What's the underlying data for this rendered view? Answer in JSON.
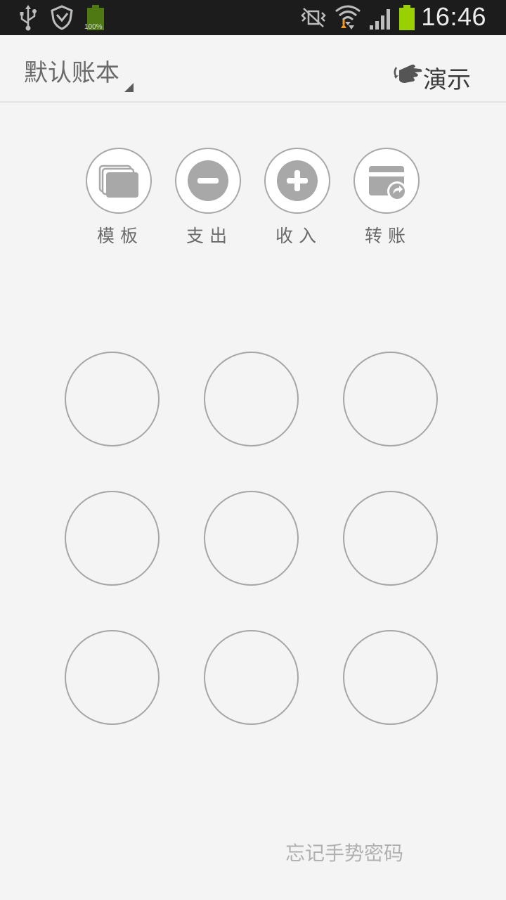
{
  "status_bar": {
    "battery_percent": "100%",
    "time": "16:46",
    "icons": [
      "usb-icon",
      "shield-icon",
      "battery-icon",
      "mute-vibrate-icon",
      "wifi-icon",
      "signal-icon",
      "battery-full-icon"
    ]
  },
  "header": {
    "account_book": "默认账本",
    "demo_label": "演示",
    "demo_icon": "hand-pointer-icon"
  },
  "actions": [
    {
      "label": "模板",
      "icon": "template-cards-icon"
    },
    {
      "label": "支出",
      "icon": "minus-circle-icon"
    },
    {
      "label": "收入",
      "icon": "plus-circle-icon"
    },
    {
      "label": "转账",
      "icon": "transfer-card-icon"
    }
  ],
  "pattern_lock": {
    "rows": 3,
    "cols": 3
  },
  "forgot_link": "忘记手势密码",
  "colors": {
    "status_bar_bg": "#1c1c1c",
    "page_bg": "#f4f4f4",
    "icon_gray": "#a8a8a8",
    "battery_green": "#9bd000"
  }
}
